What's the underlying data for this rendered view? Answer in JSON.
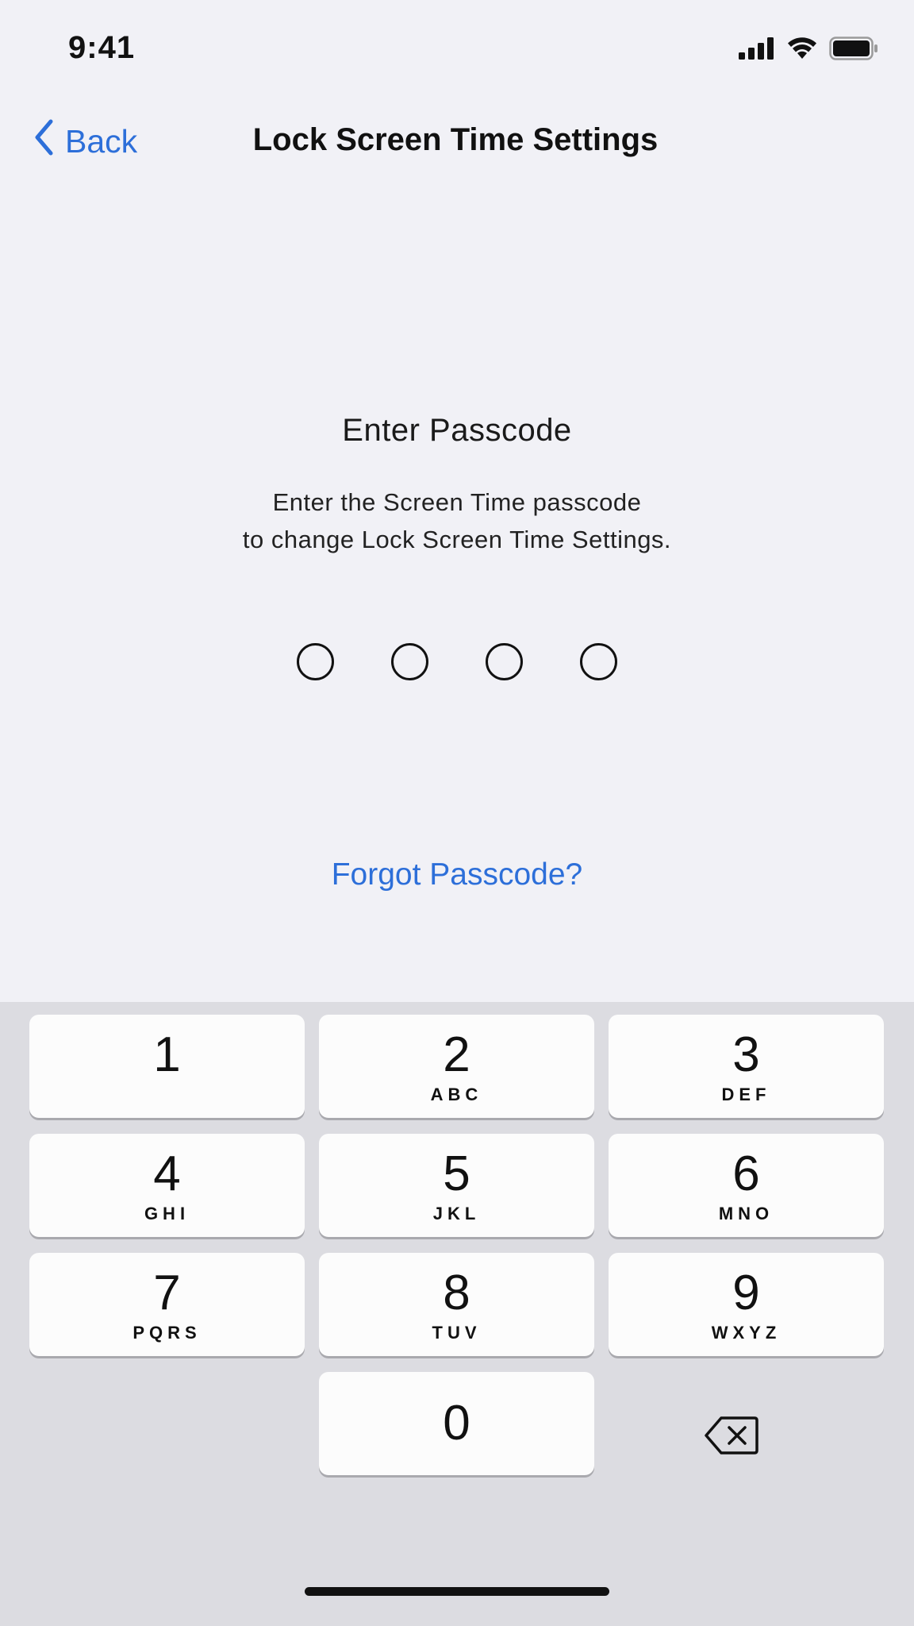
{
  "status_bar": {
    "time": "9:41",
    "icons": [
      "cellular-signal-icon",
      "wifi-icon",
      "battery-icon"
    ]
  },
  "nav": {
    "back_label": "Back",
    "title": "Lock Screen Time Settings"
  },
  "prompt": {
    "title": "Enter Passcode",
    "line1": "Enter the Screen Time passcode",
    "line2": "to change Lock Screen Time Settings."
  },
  "passcode": {
    "length": 4,
    "entered": 0
  },
  "forgot_label": "Forgot Passcode?",
  "keypad": {
    "k1": {
      "digit": "1",
      "letters": ""
    },
    "k2": {
      "digit": "2",
      "letters": "ABC"
    },
    "k3": {
      "digit": "3",
      "letters": "DEF"
    },
    "k4": {
      "digit": "4",
      "letters": "GHI"
    },
    "k5": {
      "digit": "5",
      "letters": "JKL"
    },
    "k6": {
      "digit": "6",
      "letters": "MNO"
    },
    "k7": {
      "digit": "7",
      "letters": "PQRS"
    },
    "k8": {
      "digit": "8",
      "letters": "TUV"
    },
    "k9": {
      "digit": "9",
      "letters": "WXYZ"
    },
    "k0": {
      "digit": "0",
      "letters": ""
    }
  },
  "colors": {
    "accent": "#2d6fd9",
    "background": "#f1f1f6",
    "keyboard_background": "#dcdce1",
    "key_background": "#fcfcfc"
  }
}
